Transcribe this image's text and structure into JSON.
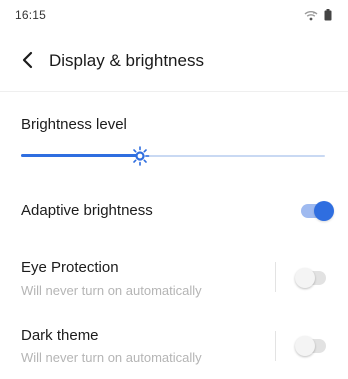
{
  "status_bar": {
    "time": "16:15",
    "icons": [
      "wifi-icon",
      "battery-icon"
    ]
  },
  "header": {
    "title": "Display & brightness",
    "back_icon": "back-arrow-icon"
  },
  "brightness": {
    "label": "Brightness level",
    "level_percent": 39,
    "accent_color": "#2f6ee0",
    "track_color": "#c9d9f3"
  },
  "settings": [
    {
      "title": "Adaptive brightness",
      "subtitle": "",
      "enabled": true
    },
    {
      "title": "Eye Protection",
      "subtitle": "Will never turn on automatically",
      "enabled": false
    },
    {
      "title": "Dark theme",
      "subtitle": "Will never turn on automatically",
      "enabled": false
    }
  ]
}
